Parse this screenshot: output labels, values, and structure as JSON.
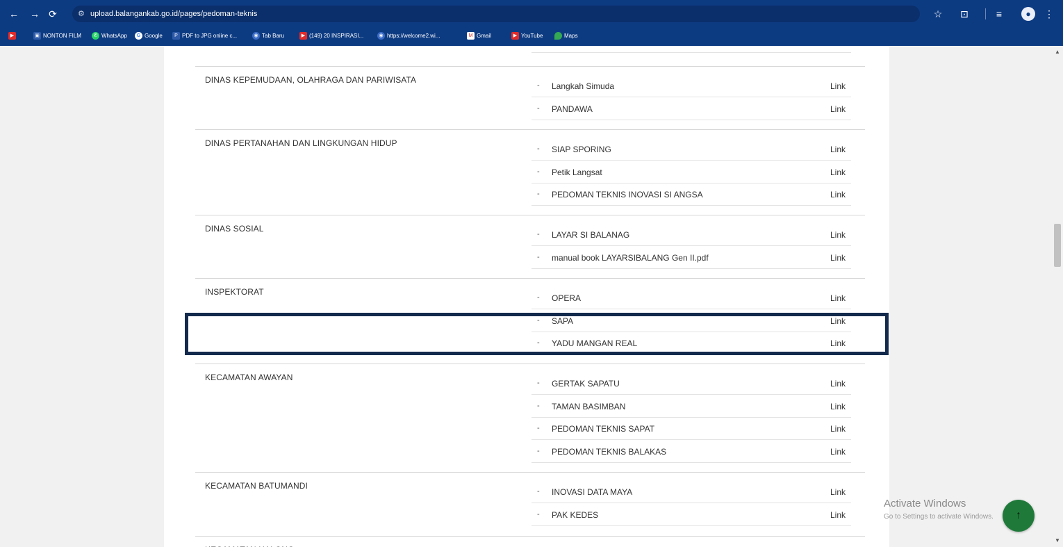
{
  "browser": {
    "url": "upload.balangankab.go.id/pages/pedoman-teknis",
    "nav": {
      "back": "←",
      "forward": "→",
      "reload": "⟳"
    },
    "toolbar_icons": [
      "star-icon",
      "extension-icon",
      "reading-list-icon",
      "profile-avatar",
      "menu-icon"
    ],
    "bookmarks": [
      {
        "label": "",
        "icon": "youtube-icon"
      },
      {
        "label": "NONTON FILM",
        "icon": "folder-icon"
      },
      {
        "label": "WhatsApp",
        "icon": "whatsapp-icon"
      },
      {
        "label": "Google",
        "icon": "google-icon"
      },
      {
        "label": "PDF to JPG online c...",
        "icon": "pdf-icon"
      },
      {
        "label": "Tab Baru",
        "icon": "globe-icon"
      },
      {
        "label": "(149) 20 INSPIRASI...",
        "icon": "youtube-icon"
      },
      {
        "label": "https://welcome2.wi...",
        "icon": "globe-icon"
      },
      {
        "label": "Gmail",
        "icon": "gmail-icon"
      },
      {
        "label": "YouTube",
        "icon": "youtube-icon"
      },
      {
        "label": "Maps",
        "icon": "maps-icon"
      }
    ]
  },
  "groups": [
    {
      "name": "DINAS KEPEMUDAAN, OLAHRAGA DAN PARIWISATA",
      "items": [
        {
          "name": "Langkah Simuda",
          "link": "Link"
        },
        {
          "name": "PANDAWA",
          "link": "Link"
        }
      ]
    },
    {
      "name": "DINAS PERTANAHAN DAN LINGKUNGAN HIDUP",
      "items": [
        {
          "name": "SIAP SPORING",
          "link": "Link"
        },
        {
          "name": "Petik Langsat",
          "link": "Link"
        },
        {
          "name": "PEDOMAN TEKNIS INOVASI SI ANGSA",
          "link": "Link"
        }
      ]
    },
    {
      "name": "DINAS SOSIAL",
      "items": [
        {
          "name": "LAYAR SI BALANAG",
          "link": "Link"
        },
        {
          "name": "manual book LAYARSIBALANG Gen II.pdf",
          "link": "Link"
        }
      ]
    },
    {
      "name": "INSPEKTORAT",
      "items": [
        {
          "name": "OPERA",
          "link": "Link"
        },
        {
          "name": "SAPA",
          "link": "Link"
        },
        {
          "name": "YADU MANGAN REAL",
          "link": "Link"
        }
      ]
    },
    {
      "name": "KECAMATAN AWAYAN",
      "items": [
        {
          "name": "GERTAK SAPATU",
          "link": "Link"
        },
        {
          "name": "TAMAN BASIMBAN",
          "link": "Link"
        },
        {
          "name": "PEDOMAN TEKNIS SAPAT",
          "link": "Link"
        },
        {
          "name": "PEDOMAN TEKNIS BALAKAS",
          "link": "Link"
        }
      ]
    },
    {
      "name": "KECAMATAN BATUMANDI",
      "items": [
        {
          "name": "INOVASI DATA MAYA",
          "link": "Link"
        },
        {
          "name": "PAK KEDES",
          "link": "Link"
        }
      ]
    },
    {
      "name": "KECAMATAN HALONG",
      "items": []
    }
  ],
  "item_dash": "-",
  "watermark": {
    "title": "Activate Windows",
    "subtitle": "Go to Settings to activate Windows."
  },
  "scroll_top_icon": "↑",
  "colors": {
    "chrome": "#0d3b82",
    "highlight": "#142a4d",
    "scroll_top": "#1f7a3a"
  }
}
